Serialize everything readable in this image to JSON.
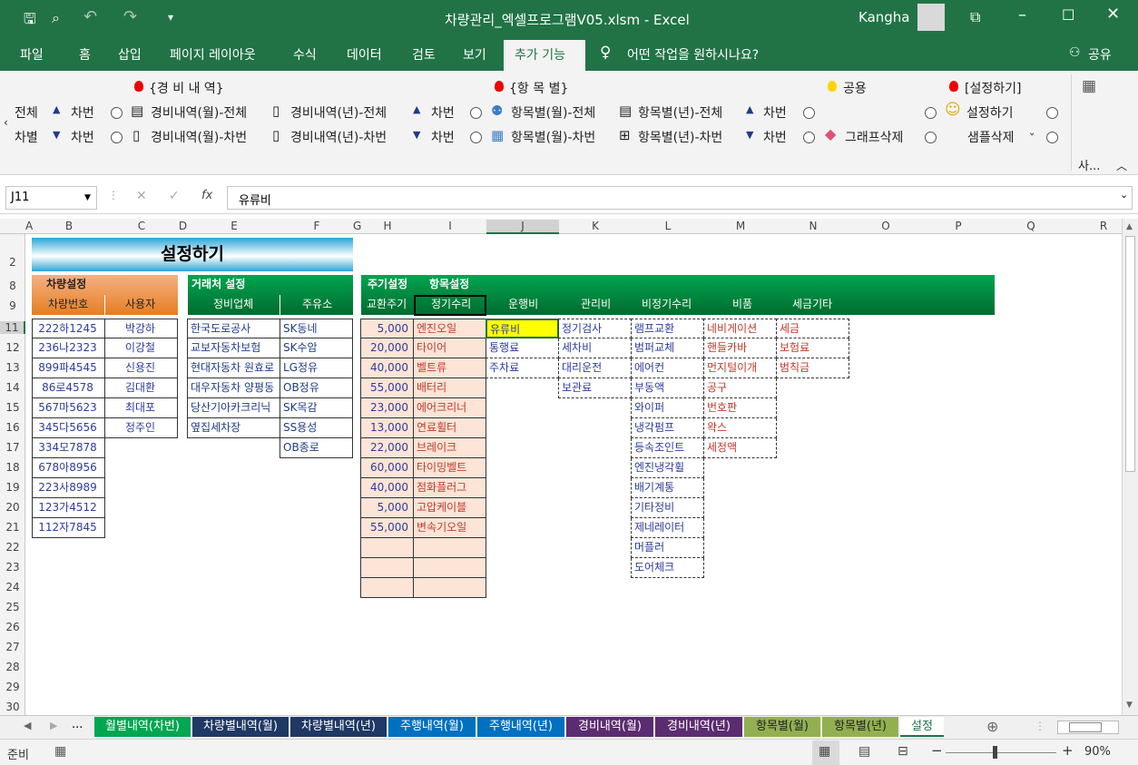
{
  "window": {
    "title": "차량관리_엑셀프로그램V05.xlsm  -  Excel",
    "user": "Kangha"
  },
  "menu": [
    "파일",
    "홈",
    "삽입",
    "페이지 레이아웃",
    "수식",
    "데이터",
    "검토",
    "보기",
    "추가 기능"
  ],
  "tell_me": "어떤 작업을 원하시나요?",
  "share": "공유",
  "ribbon": {
    "group1": "{경 비 내 역}",
    "group2": "{항 목 별}",
    "group3": "공용",
    "group4": "[설정하기]",
    "row1": [
      "전체",
      "차번",
      "경비내역(월)-전체",
      "경비내역(년)-전체",
      "차번",
      "항목별(월)-전체",
      "항목별(년)-전체",
      "차번",
      "설정하기"
    ],
    "row2": [
      "차별",
      "차번",
      "경비내역(월)-차번",
      "경비내역(년)-차번",
      "차번",
      "항목별(월)-차번",
      "항목별(년)-차번",
      "차번",
      "그래프삭제",
      "샘플삭제"
    ],
    "tail": "사..."
  },
  "namebox": "J11",
  "formula": "유류비",
  "columns": [
    "A",
    "B",
    "C",
    "D",
    "E",
    "F",
    "G",
    "H",
    "I",
    "J",
    "K",
    "L",
    "M",
    "N",
    "O",
    "P",
    "Q",
    "R"
  ],
  "rows": [
    "2",
    "8",
    "9",
    "11",
    "12",
    "13",
    "14",
    "15",
    "16",
    "17",
    "18",
    "19",
    "20",
    "21",
    "22",
    "23",
    "24",
    "25",
    "26",
    "27",
    "28",
    "29",
    "30"
  ],
  "sheet": {
    "title": "설정하기",
    "car_section": "차량설정",
    "car_no_header": "차량번호",
    "user_header": "사용자",
    "car_numbers": [
      "222하1245",
      "236나2323",
      "899파4545",
      "86로4578",
      "567마5623",
      "345다5656",
      "334모7878",
      "678아8956",
      "223사8989",
      "123가4512",
      "112자7845"
    ],
    "users": [
      "박강하",
      "이강철",
      "신용진",
      "김대환",
      "최대포",
      "정주인"
    ],
    "vendor_section": "거래처 설정",
    "repair_header": "정비업체",
    "gas_header": "주유소",
    "repair_shops": [
      "한국도로공사",
      "교보자동차보험",
      "현대자동차 원효로",
      "대우자동차 양평동",
      "당산기아카크리닉",
      "옆집세차장"
    ],
    "gas_stations": [
      "SK동네",
      "SK수암",
      "LG정유",
      "OB정유",
      "SK목감",
      "SS용성",
      "OB종로"
    ],
    "cycle_section": "주기설정",
    "item_section": "항목설정",
    "cycle_header": "교환주기",
    "item_headers": [
      "정기수리",
      "운행비",
      "관리비",
      "비정기수리",
      "비품",
      "세금기타"
    ],
    "cycles": [
      "5,000",
      "20,000",
      "40,000",
      "55,000",
      "23,000",
      "13,000",
      "22,000",
      "60,000",
      "40,000",
      "5,000",
      "55,000"
    ],
    "regular_repair": [
      "엔진오일",
      "타이어",
      "벨트류",
      "배터리",
      "에어크리너",
      "연료휠터",
      "브레이크",
      "타이밍벨트",
      "점화플러그",
      "고압케이블",
      "변속기오일"
    ],
    "operating": [
      "유류비",
      "통행료",
      "주차료"
    ],
    "management": [
      "정기검사",
      "세차비",
      "대리운전",
      "보관료"
    ],
    "irregular_repair": [
      "램프교환",
      "범퍼교체",
      "에어컨",
      "부동액",
      "와이퍼",
      "냉각펌프",
      "등속조인트",
      "엔진냉각휠",
      "배기계통",
      "기타정비",
      "제네레이터",
      "머플러",
      "도어체크"
    ],
    "supplies": [
      "네비게이션",
      "핸들카바",
      "먼지털이개",
      "공구",
      "번호판",
      "왁스",
      "세정액"
    ],
    "tax_etc": [
      "세금",
      "보험료",
      "범칙금"
    ]
  },
  "tabs": [
    {
      "label": "월별내역(차번)",
      "color": "#00a651"
    },
    {
      "label": "차량별내역(월)",
      "color": "#1f3864"
    },
    {
      "label": "차량별내역(년)",
      "color": "#1f3864"
    },
    {
      "label": "주행내역(월)",
      "color": "#0070c0"
    },
    {
      "label": "주행내역(년)",
      "color": "#0070c0"
    },
    {
      "label": "경비내역(월)",
      "color": "#5b2c6f"
    },
    {
      "label": "경비내역(년)",
      "color": "#5b2c6f"
    },
    {
      "label": "항목별(월)",
      "color": "#92b050"
    },
    {
      "label": "항목별(년)",
      "color": "#92b050"
    },
    {
      "label": "설정",
      "color": "#ffffff"
    }
  ],
  "status": {
    "ready": "준비",
    "zoom": "90%"
  }
}
